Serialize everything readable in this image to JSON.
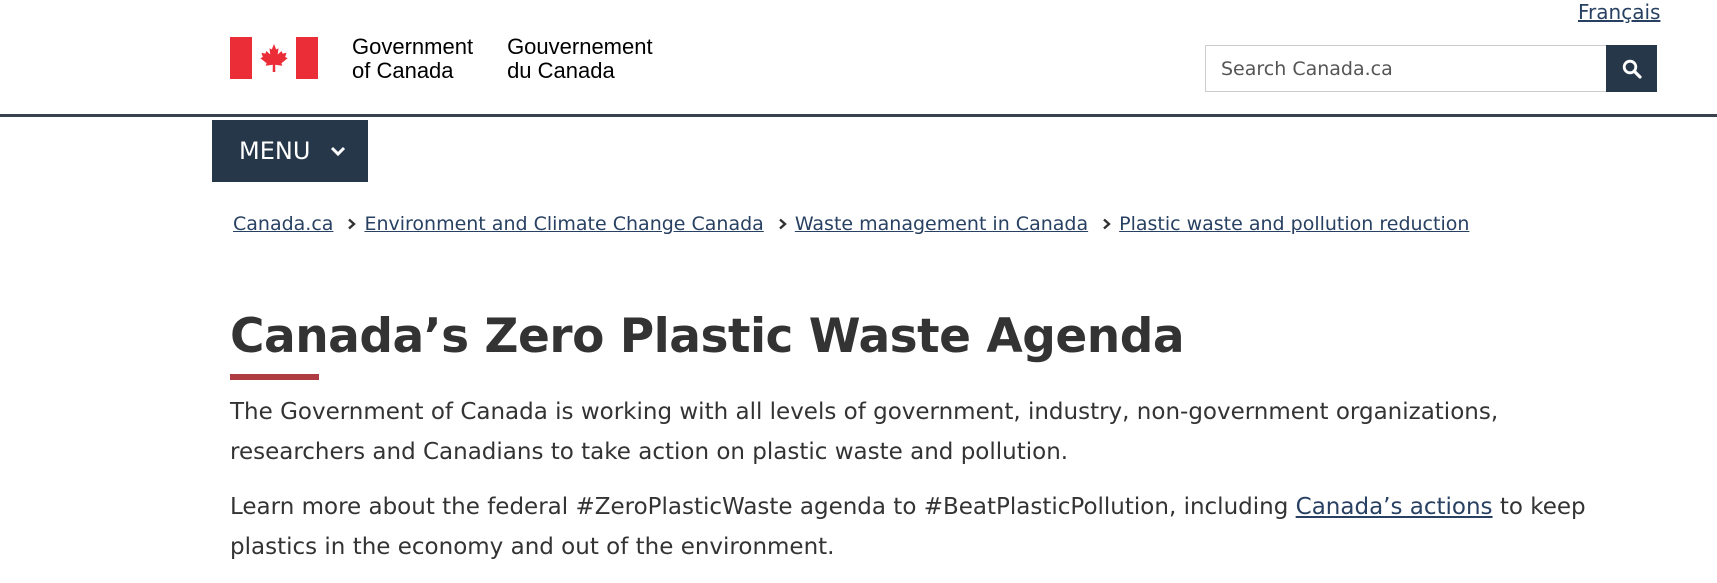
{
  "header": {
    "lang_link": "Français",
    "signature": {
      "en_line1": "Government",
      "en_line2": "of Canada",
      "fr_line1": "Gouvernement",
      "fr_line2": "du Canada"
    },
    "search": {
      "placeholder": "Search Canada.ca",
      "button_icon": "search-icon"
    }
  },
  "menu": {
    "label": "MENU",
    "icon": "chevron-down-icon"
  },
  "breadcrumb": {
    "items": [
      "Canada.ca",
      "Environment and Climate Change Canada",
      "Waste management in Canada",
      "Plastic waste and pollution reduction"
    ]
  },
  "main": {
    "title": "Canada’s Zero Plastic Waste Agenda",
    "paragraph1": "The Government of Canada is working with all levels of government, industry, non-government organizations, researchers and Canadians to take action on plastic waste and pollution.",
    "paragraph2_before": "Learn more about the federal #ZeroPlasticWaste agenda to #BeatPlasticPollution, including ",
    "paragraph2_link": "Canada’s actions",
    "paragraph2_after": " to keep plastics in the economy and out of the environment."
  },
  "colors": {
    "link": "#284162",
    "nav_dark": "#26374a",
    "flag_red": "#eb2d37",
    "title_accent": "#af3c43",
    "text": "#333333"
  }
}
